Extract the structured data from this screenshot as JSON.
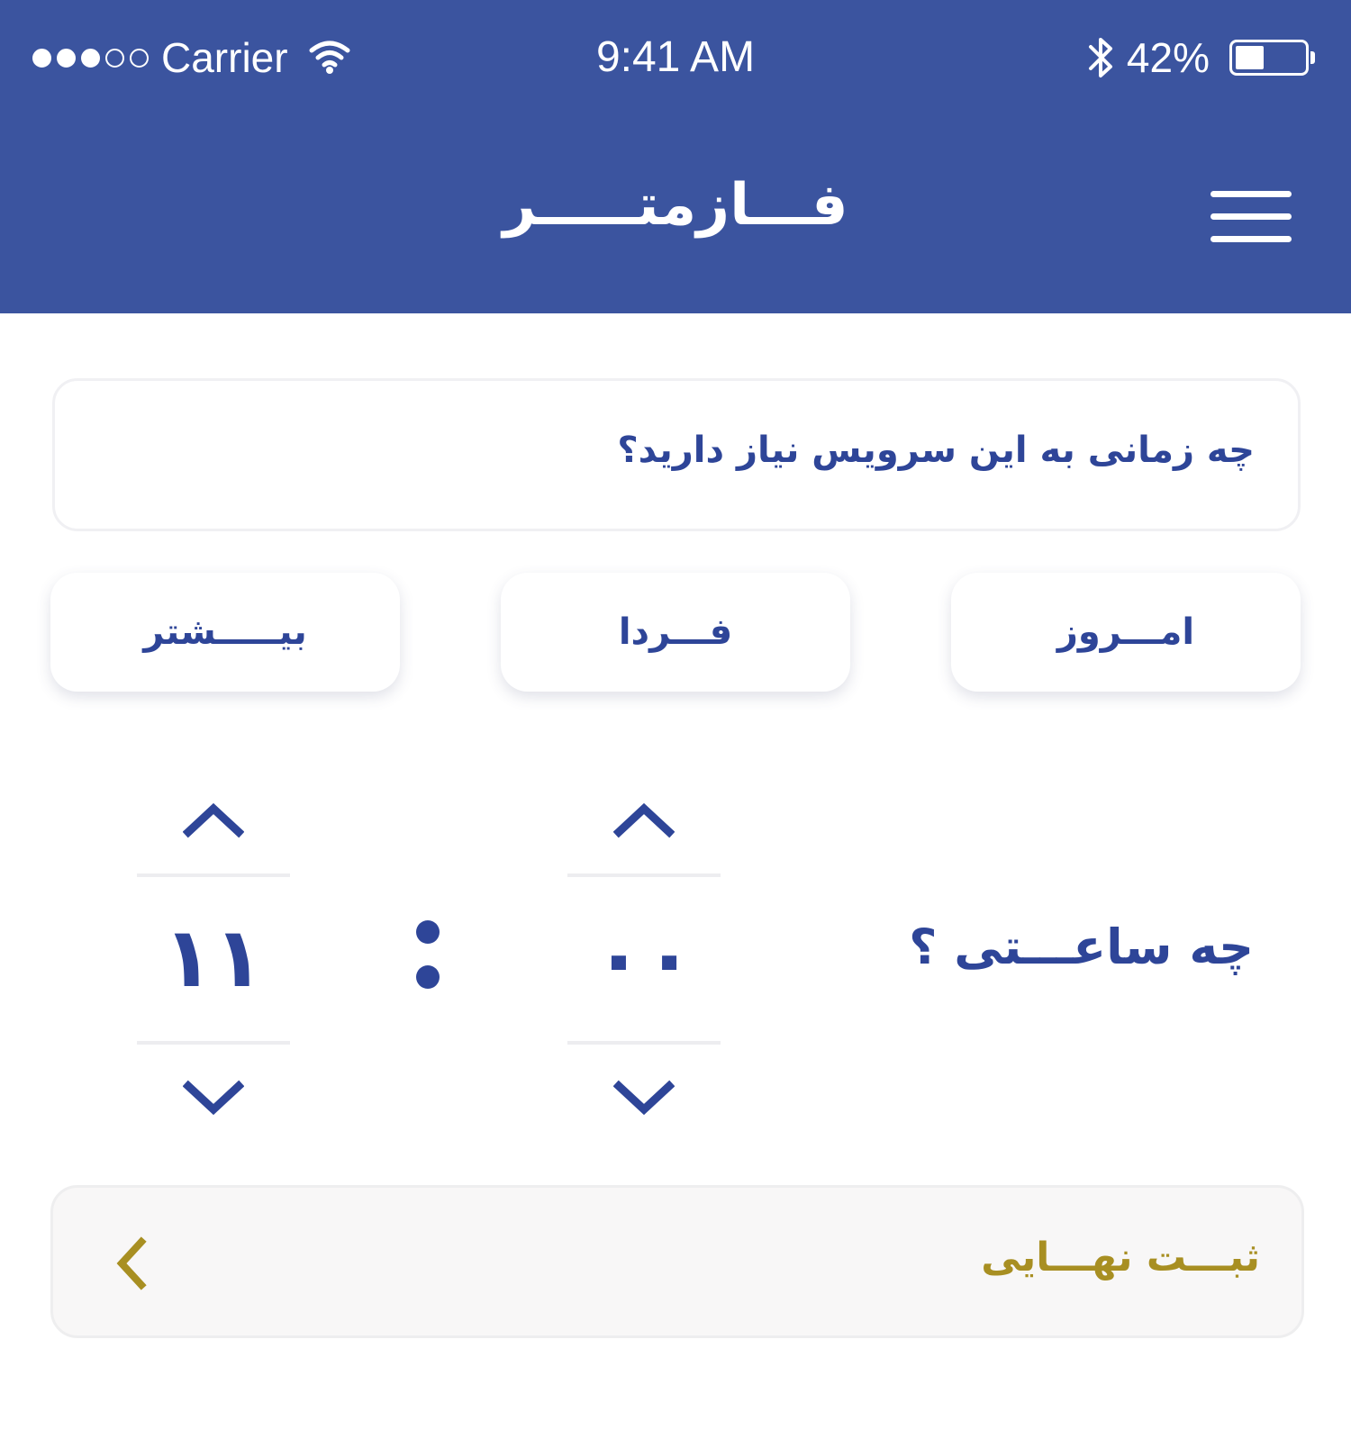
{
  "status_bar": {
    "carrier": "Carrier",
    "time": "9:41 AM",
    "battery_percent": "42%",
    "battery_level": 0.42,
    "signal_bars_filled": 3,
    "signal_bars_total": 5
  },
  "header": {
    "title": "فـــازمتـــــر",
    "menu_icon": "hamburger-menu-icon"
  },
  "question": {
    "text": "چه زمانی به این سرویس نیاز دارید؟"
  },
  "day_options": {
    "today": "امـــروز",
    "tomorrow": "فـــردا",
    "more": "بیـــــشتر"
  },
  "time_picker": {
    "label": "چه ساعـــتی ؟",
    "hour": "۱۱",
    "minute": "۰۰",
    "up_icon": "chevron-up-icon",
    "down_icon": "chevron-down-icon"
  },
  "submit": {
    "label": "ثبـــت نهـــایی",
    "icon": "chevron-left-icon"
  },
  "colors": {
    "primary": "#3b549f",
    "text_blue": "#2e4598",
    "accent_gold": "#a88f22",
    "submit_bg": "#f8f7f7"
  }
}
